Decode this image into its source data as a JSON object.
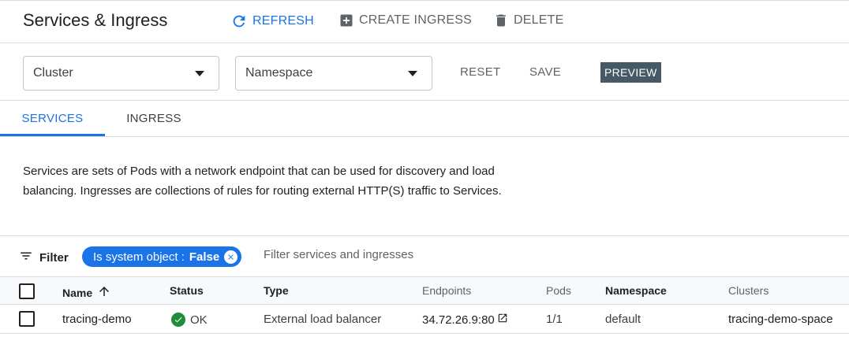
{
  "header": {
    "title": "Services & Ingress",
    "refresh_label": "REFRESH",
    "create_ingress_label": "CREATE INGRESS",
    "delete_label": "DELETE"
  },
  "filters": {
    "cluster_label": "Cluster",
    "namespace_label": "Namespace",
    "reset_label": "RESET",
    "save_label": "SAVE",
    "preview_badge": "PREVIEW"
  },
  "tabs": [
    {
      "label": "SERVICES",
      "active": true
    },
    {
      "label": "INGRESS",
      "active": false
    }
  ],
  "description": "Services are sets of Pods with a network endpoint that can be used for discovery and load balancing. Ingresses are collections of rules for routing external HTTP(S) traffic to Services.",
  "filter_bar": {
    "label": "Filter",
    "chip_key": "Is system object :",
    "chip_value": "False",
    "placeholder": "Filter services and ingresses"
  },
  "table": {
    "columns": [
      "Name",
      "Status",
      "Type",
      "Endpoints",
      "Pods",
      "Namespace",
      "Clusters"
    ],
    "rows": [
      {
        "name": "tracing-demo",
        "status": "OK",
        "type": "External load balancer",
        "endpoints": "34.72.26.9:80",
        "pods": "1/1",
        "namespace": "default",
        "clusters": "tracing-demo-space"
      }
    ]
  },
  "colors": {
    "accent": "#1a73e8",
    "status_ok": "#1e8e3e",
    "preview_badge_bg": "#455a64"
  },
  "icons": {
    "refresh": "refresh-icon",
    "create": "add-box-icon",
    "delete": "trash-icon",
    "filter": "filter-icon",
    "sort": "arrow-up-icon",
    "status_ok": "check-circle-icon",
    "external_link": "open-in-new-icon"
  }
}
